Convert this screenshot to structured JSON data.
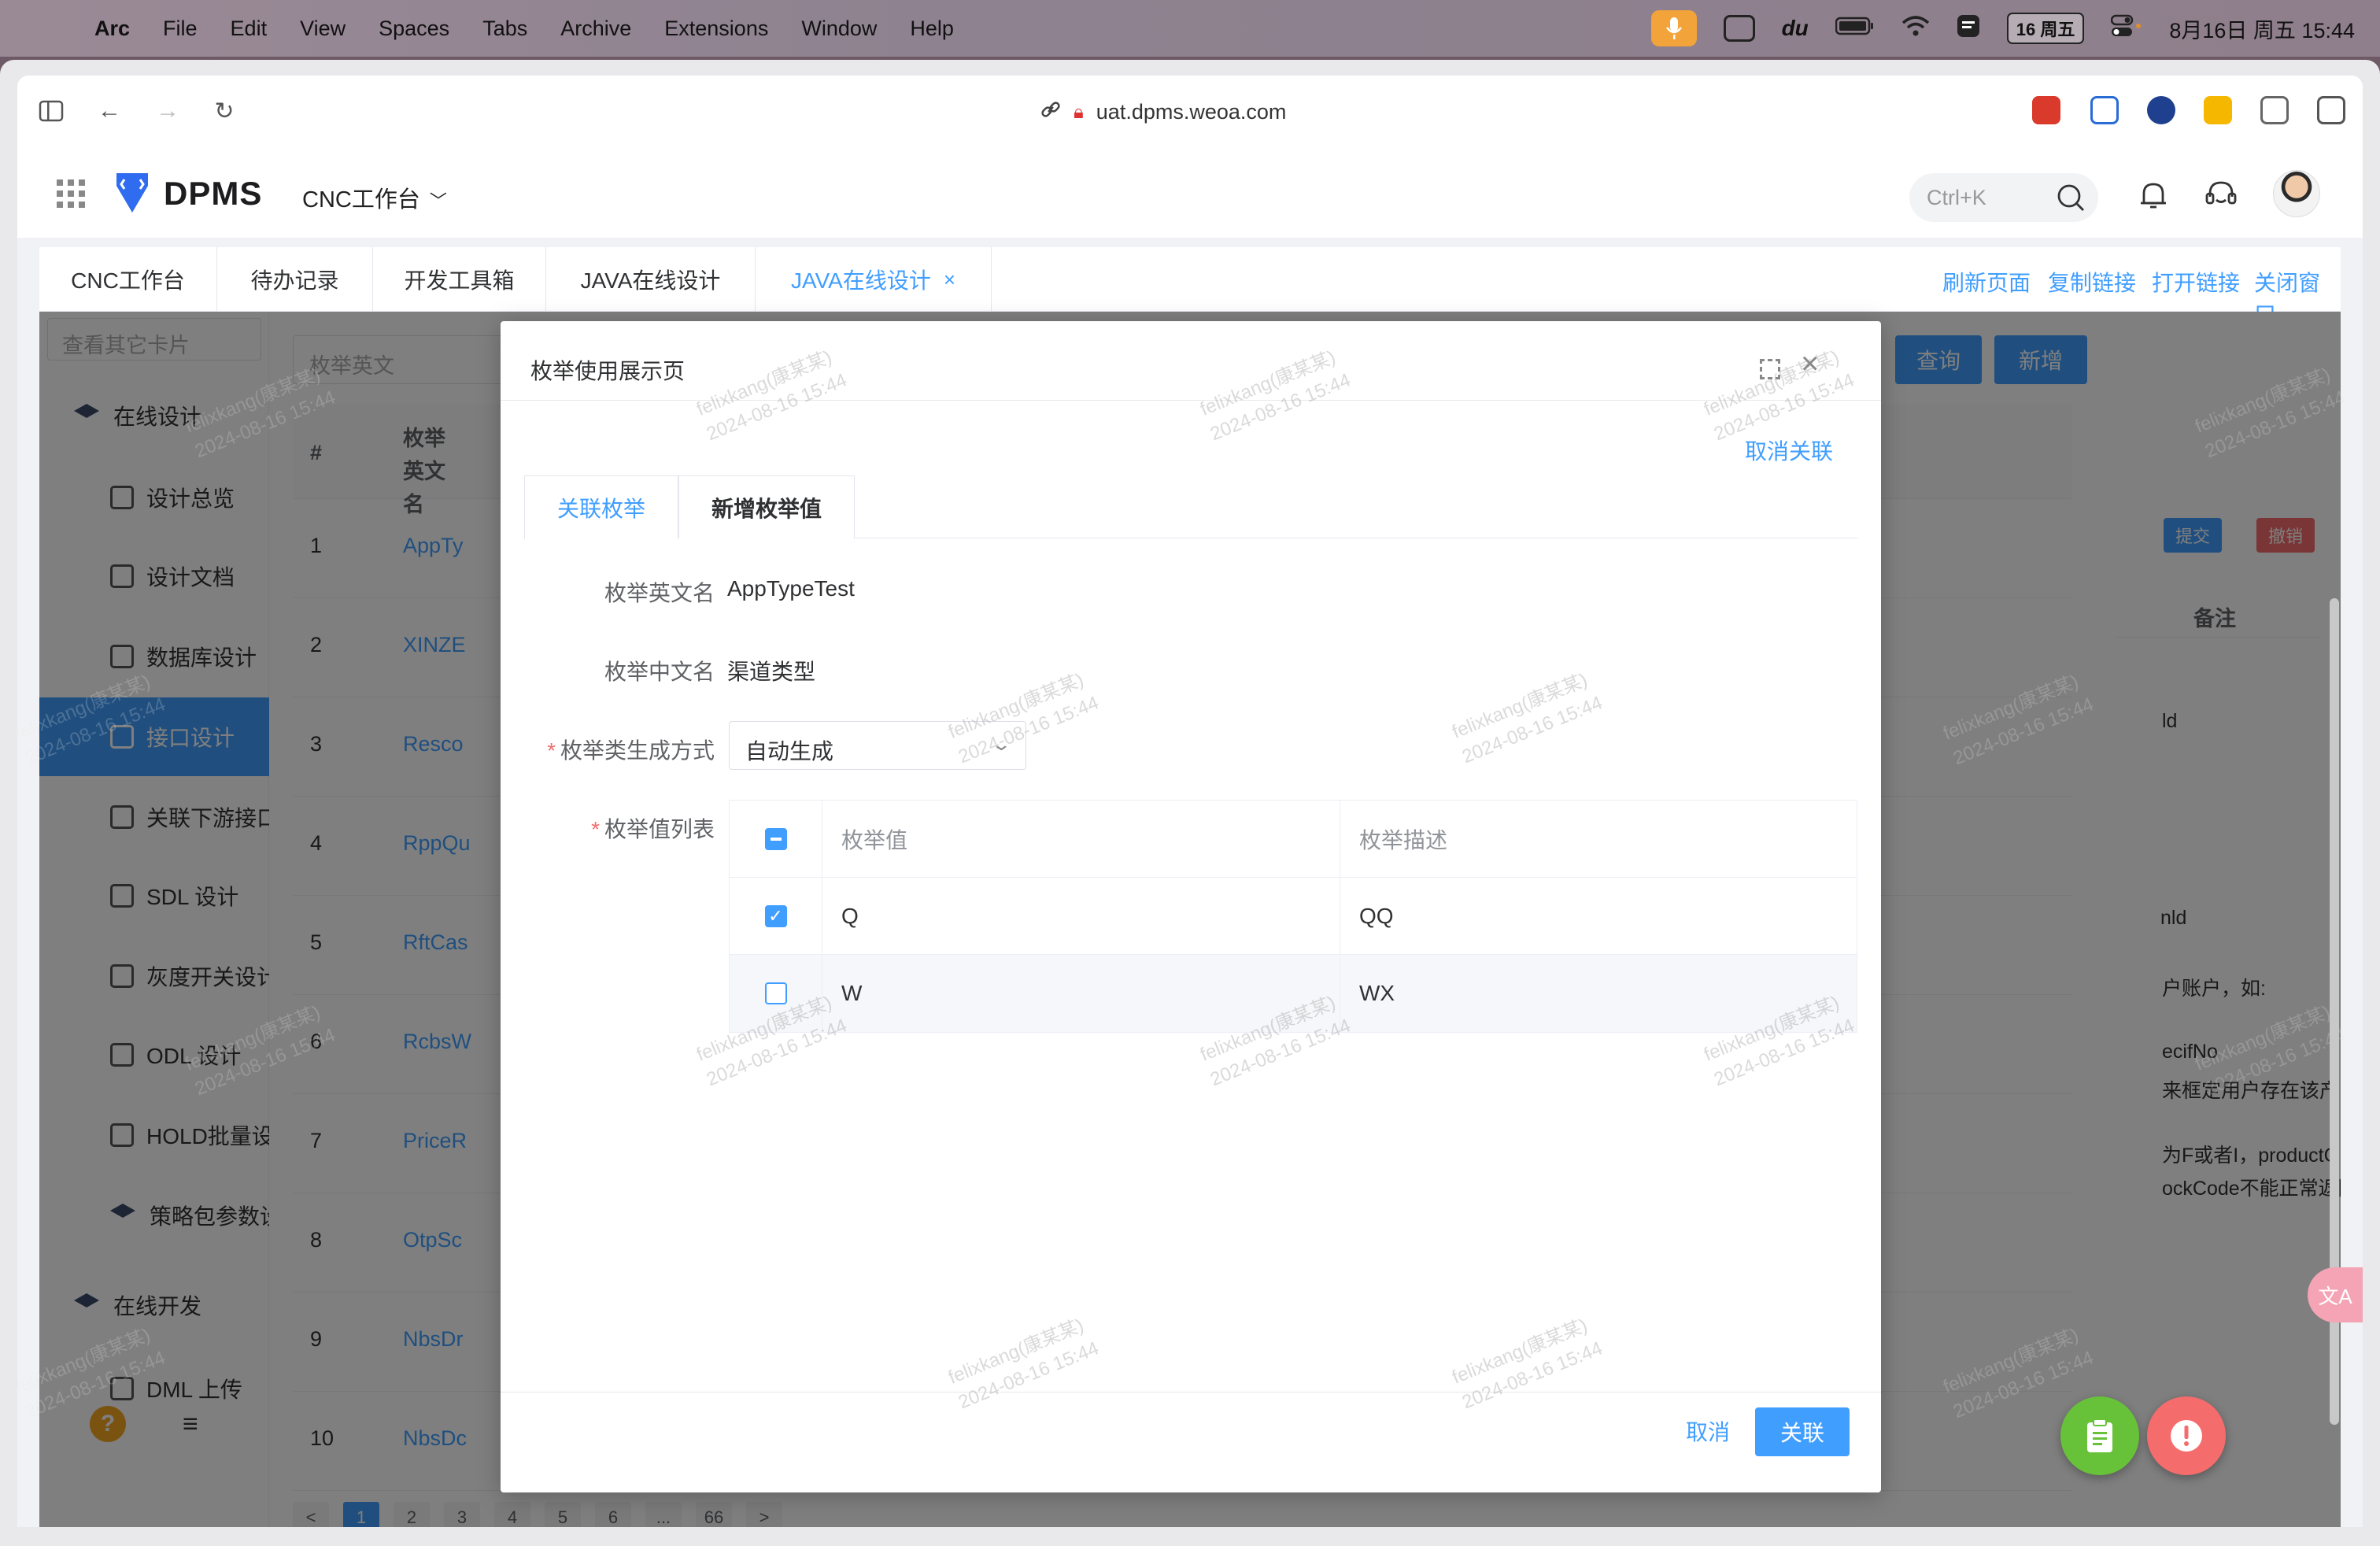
{
  "menubar": {
    "app": "Arc",
    "items": [
      "File",
      "Edit",
      "View",
      "Spaces",
      "Tabs",
      "Archive",
      "Extensions",
      "Window",
      "Help"
    ],
    "calendar_badge": "16 周五",
    "clock": "8月16日 周五  15:44"
  },
  "browser": {
    "url": "uat.dpms.weoa.com"
  },
  "app_header": {
    "logo": "DPMS",
    "workspace": "CNC工作台",
    "search_placeholder": "Ctrl+K"
  },
  "tabs": [
    {
      "label": "CNC工作台"
    },
    {
      "label": "待办记录"
    },
    {
      "label": "开发工具箱"
    },
    {
      "label": "JAVA在线设计"
    },
    {
      "label": "JAVA在线设计",
      "close": "×"
    }
  ],
  "tab_links": [
    "刷新页面",
    "复制链接",
    "打开链接",
    "关闭窗口"
  ],
  "sidebar": {
    "search_placeholder": "查看其它卡片",
    "items": [
      {
        "label": "在线设计"
      },
      {
        "label": "设计总览"
      },
      {
        "label": "设计文档"
      },
      {
        "label": "数据库设计"
      },
      {
        "label": "接口设计"
      },
      {
        "label": "关联下游接口"
      },
      {
        "label": "SDL 设计"
      },
      {
        "label": "灰度开关设计"
      },
      {
        "label": "ODL 设计"
      },
      {
        "label": "HOLD批量设计"
      },
      {
        "label": "策略包参数设"
      },
      {
        "label": "在线开发"
      },
      {
        "label": "DML 上传"
      }
    ],
    "help": "?",
    "menu": "≡"
  },
  "background_page": {
    "search_placeholder": "枚举英文",
    "query_button": "查询",
    "add_button": "新增",
    "table_header": {
      "num": "#",
      "name": "枚举英文名"
    },
    "rows": [
      {
        "num": "1",
        "name": "AppTy"
      },
      {
        "num": "2",
        "name": "XINZE"
      },
      {
        "num": "3",
        "name": "Resco"
      },
      {
        "num": "4",
        "name": "RppQu"
      },
      {
        "num": "5",
        "name": "RftCas"
      },
      {
        "num": "6",
        "name": "RcbsW"
      },
      {
        "num": "7",
        "name": "PriceR"
      },
      {
        "num": "8",
        "name": "OtpSc"
      },
      {
        "num": "9",
        "name": "NbsDr"
      },
      {
        "num": "10",
        "name": "NbsDc"
      }
    ],
    "right_panel": {
      "submit": "提交",
      "revoke": "撤销",
      "remark_header": "备注",
      "texts": [
        "ld",
        "nld",
        "户账户，如:",
        "ecifNo",
        "来框定用户存在该产",
        "为F或者I，productC",
        "ockCode不能正常返回"
      ]
    },
    "pager": [
      "<",
      "1",
      "2",
      "3",
      "4",
      "5",
      "6",
      "...",
      "66",
      ">"
    ]
  },
  "modal": {
    "title": "枚举使用展示页",
    "unlink": "取消关联",
    "tabs": [
      "关联枚举",
      "新增枚举值"
    ],
    "fields": {
      "en_name_label": "枚举英文名",
      "en_name_value": "AppTypeTest",
      "cn_name_label": "枚举中文名",
      "cn_name_value": "渠道类型",
      "gen_label": "枚举类生成方式",
      "gen_value": "自动生成",
      "list_label": "枚举值列表"
    },
    "table": {
      "headers": [
        "枚举值",
        "枚举描述"
      ],
      "rows": [
        {
          "value": "Q",
          "desc": "QQ",
          "checked": true
        },
        {
          "value": "W",
          "desc": "WX",
          "checked": false
        }
      ]
    },
    "cancel": "取消",
    "confirm": "关联"
  },
  "watermark": {
    "user": "felixkang(康某某)",
    "time": "2024-08-16 15:44"
  },
  "colors": {
    "primary": "#409eff",
    "required": "#f56c6c",
    "fab_green": "#67c23a",
    "fab_red": "#f56c6c"
  }
}
